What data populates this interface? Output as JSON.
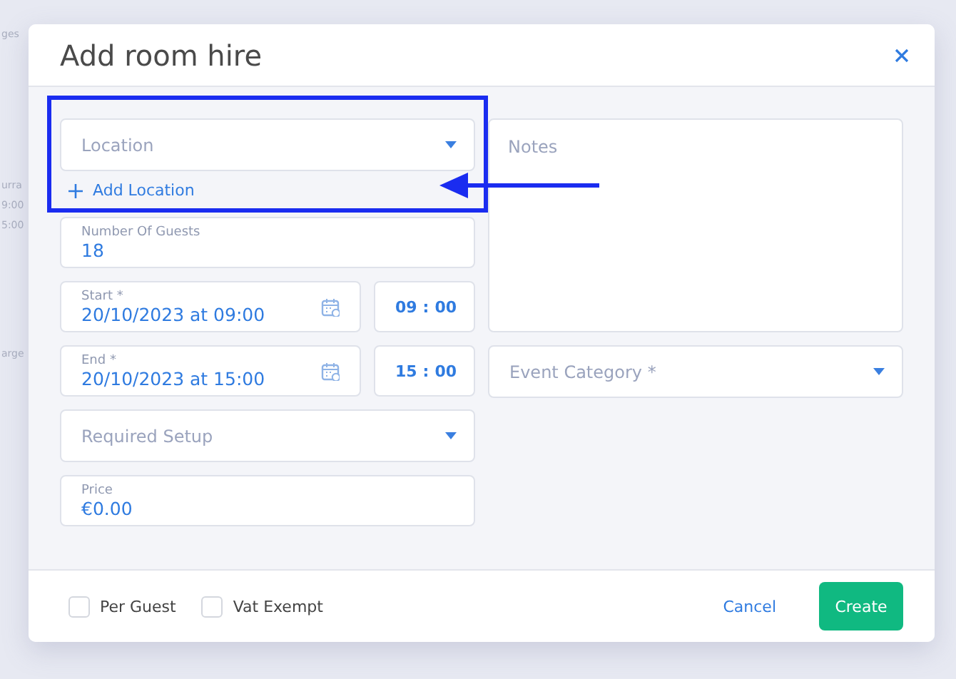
{
  "background_fragments": [
    {
      "text": "ges"
    },
    {
      "text": "urra"
    },
    {
      "text": "9:00"
    },
    {
      "text": "5:00"
    },
    {
      "text": "arge"
    }
  ],
  "dialog": {
    "title": "Add room hire",
    "fields": [
      {
        "kind": "select",
        "placeholder": "Location"
      },
      {
        "kind": "link",
        "label": "Add Location"
      },
      {
        "kind": "text",
        "label": "Number Of Guests",
        "value": "18"
      },
      {
        "kind": "datetime",
        "label": "Start *",
        "value": "20/10/2023 at 09:00",
        "hour": "09",
        "separator": ":",
        "minute": "00"
      },
      {
        "kind": "datetime",
        "label": "End *",
        "value": "20/10/2023 at 15:00",
        "hour": "15",
        "separator": ":",
        "minute": "00"
      },
      {
        "kind": "select",
        "placeholder": "Required Setup"
      },
      {
        "kind": "text",
        "label": "Price",
        "value": "€0.00"
      }
    ],
    "notes": {
      "placeholder": "Notes"
    },
    "event_category": {
      "placeholder": "Event Category *"
    },
    "checkboxes": [
      {
        "label": "Per Guest",
        "checked": false
      },
      {
        "label": "Vat Exempt",
        "checked": false
      }
    ],
    "buttons": [
      {
        "kind": "link",
        "label": "Cancel"
      },
      {
        "kind": "primary",
        "label": "Create"
      }
    ]
  },
  "annotation": {
    "highlight_box": true,
    "arrow": true
  }
}
